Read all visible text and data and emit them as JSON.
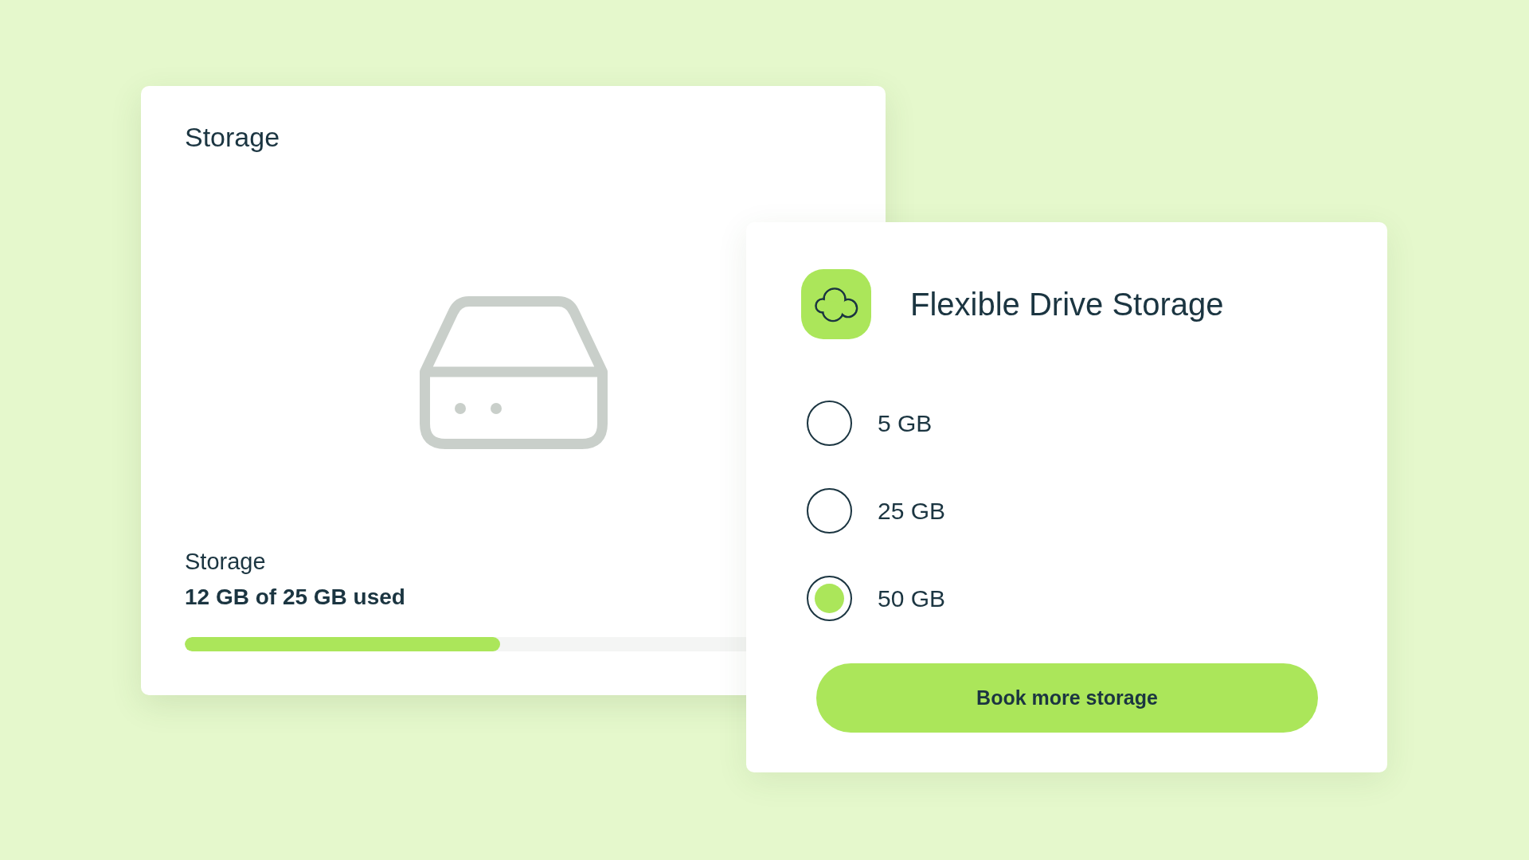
{
  "storage_card": {
    "title": "Storage",
    "usage_label": "Storage",
    "usage_text": "12 GB of 25 GB used",
    "usage_bar": {
      "level": 0.48
    }
  },
  "plan_card": {
    "title": "Flexible Drive Storage",
    "options": [
      {
        "label": "5 GB",
        "selected": false
      },
      {
        "label": "25 GB",
        "selected": false
      },
      {
        "label": "50 GB",
        "selected": true
      }
    ],
    "button": "Book more storage"
  }
}
